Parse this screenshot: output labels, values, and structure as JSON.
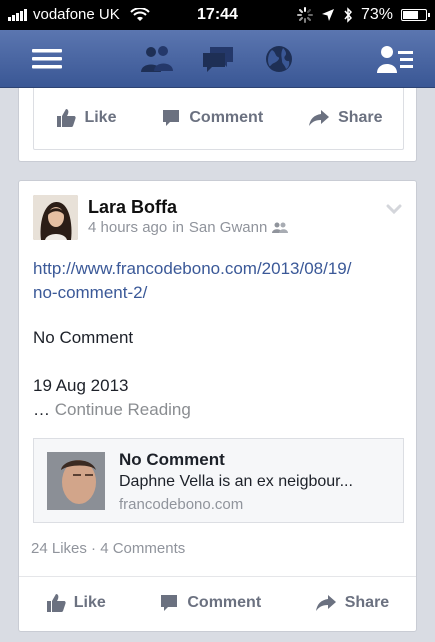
{
  "status_bar": {
    "carrier": "vodafone UK",
    "time": "17:44",
    "battery": "73%",
    "battery_level": 0.73,
    "signal_icon": "signal-bars-icon",
    "wifi_icon": "wifi-icon",
    "activity_icon": "activity-spinner-icon",
    "location_icon": "location-arrow-icon",
    "bluetooth_icon": "bluetooth-icon",
    "battery_icon": "battery-icon"
  },
  "navbar": {
    "menu_icon": "menu-icon",
    "friends_icon": "friend-requests-icon",
    "messages_icon": "messages-icon",
    "notifications_icon": "globe-notifications-icon",
    "contacts_icon": "contacts-list-icon",
    "bg_color": "#3b5998"
  },
  "top_card": {
    "actions": {
      "like": "Like",
      "comment": "Comment",
      "share": "Share"
    }
  },
  "post": {
    "author": "Lara Boffa",
    "time": "4 hours ago",
    "location_prefix": "in",
    "location": "San Gwann",
    "privacy_icon": "friends-privacy-icon",
    "link_line1": "http://www.francodebono.com/2013/08/19/",
    "link_line2": "no-comment-2/",
    "body": "No Comment",
    "date": "19 Aug 2013",
    "ellipsis": "…",
    "continue": "Continue Reading",
    "shared_link": {
      "title": "No Comment",
      "description": "Daphne Vella is an ex neigbour...",
      "domain": "francodebono.com"
    },
    "likes": "24 Likes",
    "separator": "·",
    "comments": "4 Comments",
    "actions": {
      "like": "Like",
      "comment": "Comment",
      "share": "Share"
    },
    "link_color": "#3b5998"
  }
}
